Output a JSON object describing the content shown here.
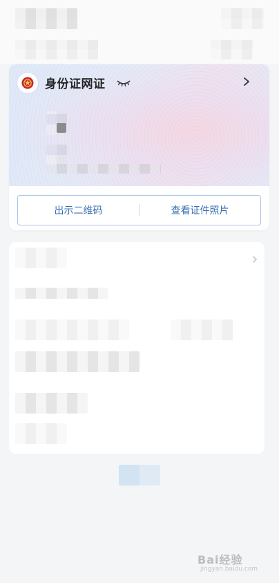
{
  "id_card": {
    "title": "身份证网证",
    "icons": {
      "emblem": "national-emblem-icon",
      "visibility": "eye-closed-icon",
      "open": "chevron-right-icon"
    },
    "actions": {
      "show_qr": "出示二维码",
      "view_photo": "查看证件照片"
    }
  },
  "watermark": {
    "brand": "Bai经验",
    "domain": "jingyan.baidu.com"
  },
  "colors": {
    "accent": "#3a6fb3",
    "button_border": "#a9c4e6",
    "emblem_red": "#c8232c"
  }
}
